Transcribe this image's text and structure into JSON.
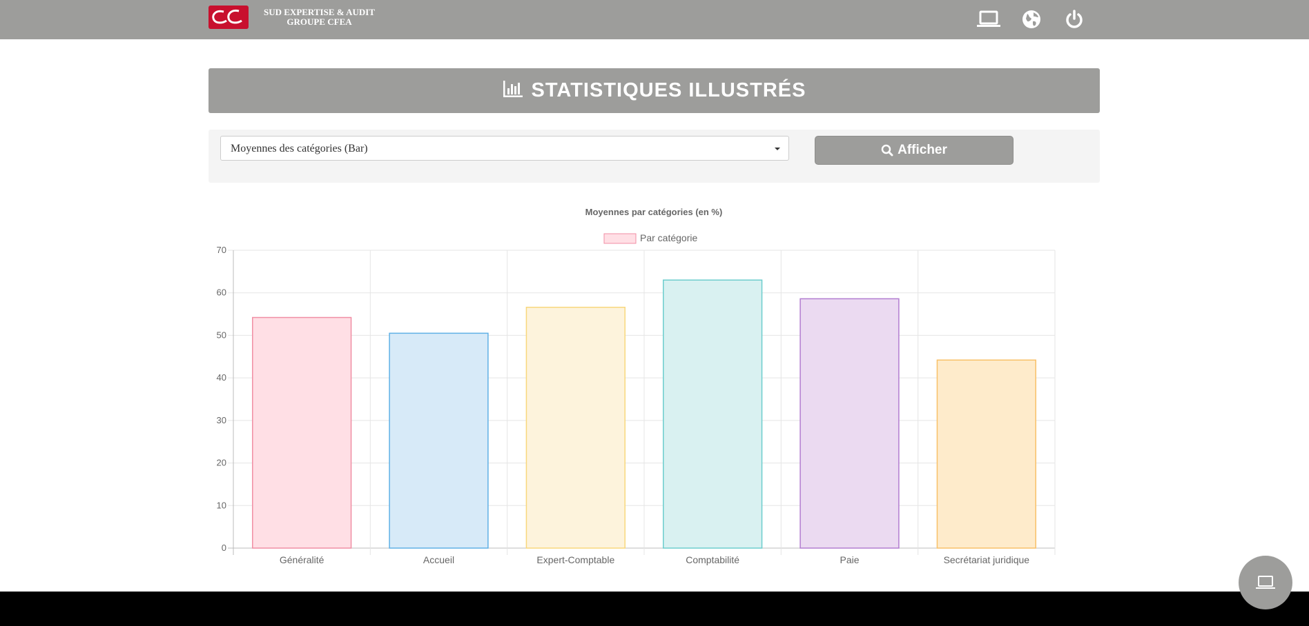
{
  "brand": {
    "line1": "SUD EXPERTISE & AUDIT",
    "line2": "GROUPE CFEA"
  },
  "nav": {
    "icons": [
      "laptop-icon",
      "globe-icon",
      "power-icon"
    ]
  },
  "page": {
    "title": "STATISTIQUES ILLUSTRÉS"
  },
  "filter": {
    "selected": "Moyennes des catégories (Bar)",
    "button_label": "Afficher"
  },
  "colors": {
    "bar_gray": "#9d9d9b",
    "panel": "#f4f4f4",
    "footer": "#000000"
  },
  "chart_data": {
    "type": "bar",
    "title": "Moyennes par catégories (en %)",
    "legend": "Par catégorie",
    "legend_position": "top",
    "grid": true,
    "categories": [
      "Généralité",
      "Accueil",
      "Expert-Comptable",
      "Comptabilité",
      "Paie",
      "Secrétariat juridique"
    ],
    "values": [
      54.2,
      50.5,
      56.6,
      63.0,
      58.6,
      44.2
    ],
    "ylim": [
      0,
      70
    ],
    "yticks": [
      0,
      10,
      20,
      30,
      40,
      50,
      60,
      70
    ],
    "fills": [
      "#ffdfe5",
      "#d7eaf8",
      "#fdf3dc",
      "#d9f1f1",
      "#ebdaf1",
      "#feebcb"
    ],
    "borders": [
      "#f08ea4",
      "#5fb0e6",
      "#f8d77c",
      "#6ccdcd",
      "#b27dd0",
      "#f8c068"
    ]
  }
}
